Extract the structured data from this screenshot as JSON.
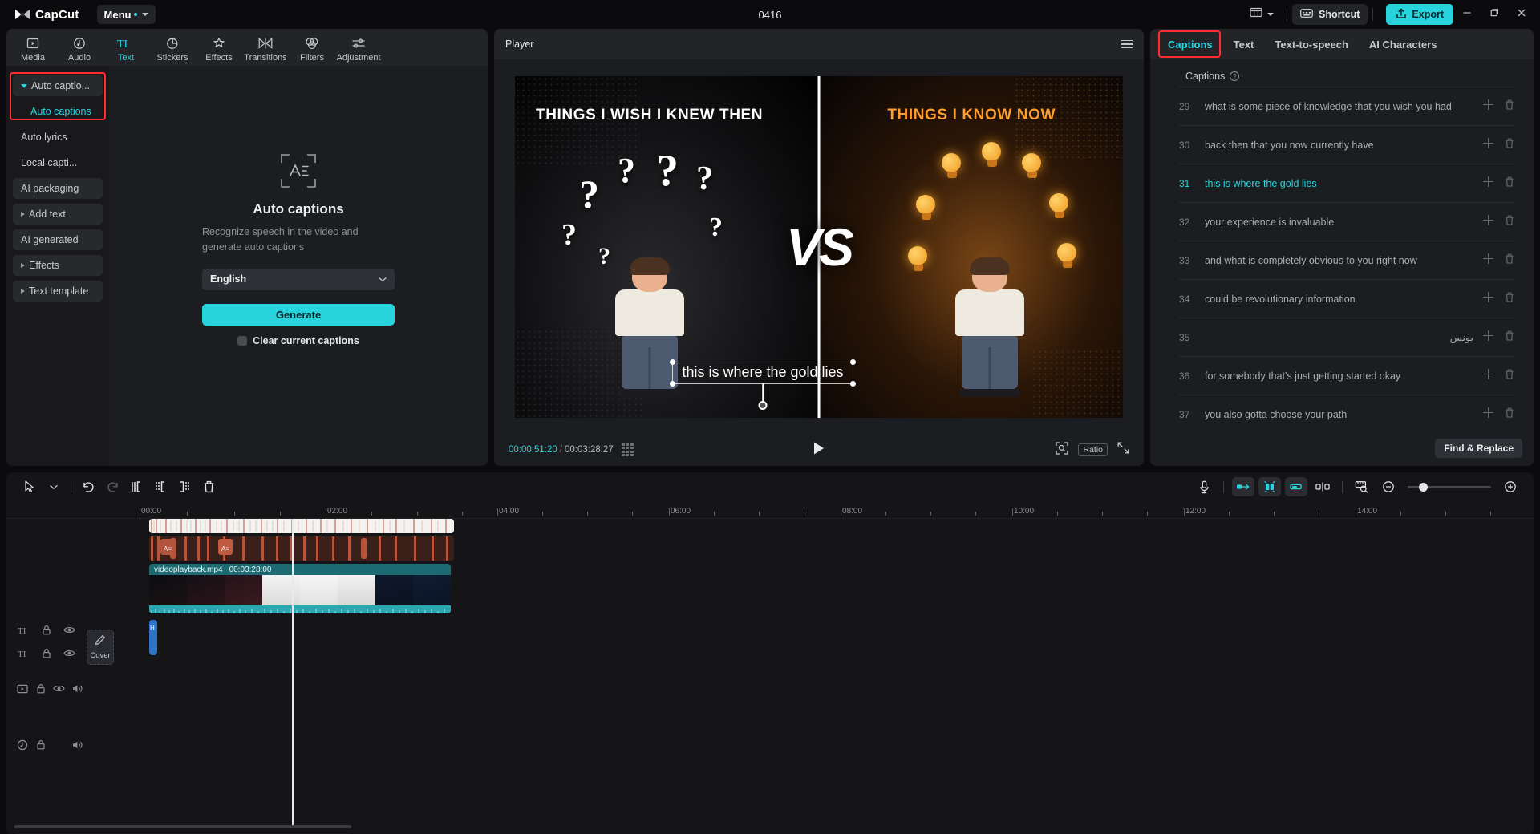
{
  "titlebar": {
    "app_name": "CapCut",
    "menu_label": "Menu",
    "project_title": "0416",
    "layout_icon": "layout-icon",
    "shortcut_label": "Shortcut",
    "export_label": "Export",
    "minimize_icon": "minimize-icon",
    "maximize_icon": "maximize-icon",
    "close_icon": "close-icon",
    "accent": "#27d4dd"
  },
  "toolstrip": {
    "items": [
      {
        "label": "Media",
        "icon": "media-icon",
        "active": false
      },
      {
        "label": "Audio",
        "icon": "audio-icon",
        "active": false
      },
      {
        "label": "Text",
        "icon": "text-icon",
        "active": true
      },
      {
        "label": "Stickers",
        "icon": "stickers-icon",
        "active": false
      },
      {
        "label": "Effects",
        "icon": "effects-icon",
        "active": false
      },
      {
        "label": "Transitions",
        "icon": "transitions-icon",
        "active": false
      },
      {
        "label": "Filters",
        "icon": "filters-icon",
        "active": false
      },
      {
        "label": "Adjustment",
        "icon": "adjustment-icon",
        "active": false
      }
    ]
  },
  "subnav": {
    "items": [
      {
        "label": "Auto captio...",
        "expandable": true,
        "expanded": true,
        "highlighted": true
      },
      {
        "label": "Auto captions",
        "child": true,
        "selected": true
      },
      {
        "label": "Auto lyrics",
        "expandable": false
      },
      {
        "label": "Local capti...",
        "expandable": false
      },
      {
        "label": "AI packaging",
        "expandable": false
      },
      {
        "label": "Add text",
        "expandable": true
      },
      {
        "label": "AI generated",
        "expandable": false
      },
      {
        "label": "Effects",
        "expandable": true
      },
      {
        "label": "Text template",
        "expandable": true
      }
    ]
  },
  "auto_captions": {
    "icon": "auto-captions-icon",
    "title": "Auto captions",
    "description": "Recognize speech in the video and generate auto captions",
    "language_value": "English",
    "generate_label": "Generate",
    "clear_label": "Clear current captions",
    "clear_checked": false
  },
  "player": {
    "title": "Player",
    "menu_icon": "hamburger-icon",
    "current_time": "00:00:51:20",
    "time_separator": "/",
    "total_time": "00:03:28:27",
    "frames_icon": "frames-icon",
    "play_icon": "play-icon",
    "fit_icon": "fit-to-screen-icon",
    "ratio_label": "Ratio",
    "fullscreen_icon": "fullscreen-icon",
    "video": {
      "left_title": "THINGS I WISH I KNEW THEN",
      "right_title": "THINGS I KNOW NOW",
      "vs_label": "VS",
      "caption_overlay": "this is where the gold lies"
    }
  },
  "right_panel": {
    "tabs": [
      {
        "label": "Captions",
        "active": true,
        "highlighted": true
      },
      {
        "label": "Text",
        "active": false
      },
      {
        "label": "Text-to-speech",
        "active": false
      },
      {
        "label": "AI Characters",
        "active": false
      }
    ],
    "section_label": "Captions",
    "help_icon": "help-icon",
    "find_replace_label": "Find & Replace",
    "add_icon": "plus-icon",
    "delete_icon": "trash-icon",
    "captions": [
      {
        "num": "29",
        "text": "what is some piece of knowledge that you wish you had",
        "active": false,
        "rtl": false
      },
      {
        "num": "30",
        "text": "back then that you now currently have",
        "active": false,
        "rtl": false
      },
      {
        "num": "31",
        "text": "this is where the gold lies",
        "active": true,
        "rtl": false
      },
      {
        "num": "32",
        "text": "your experience is invaluable",
        "active": false,
        "rtl": false
      },
      {
        "num": "33",
        "text": "and what is completely obvious to you right now",
        "active": false,
        "rtl": false
      },
      {
        "num": "34",
        "text": "could be revolutionary information",
        "active": false,
        "rtl": false
      },
      {
        "num": "35",
        "text": "یونس",
        "active": false,
        "rtl": true
      },
      {
        "num": "36",
        "text": "for somebody that's just getting started okay",
        "active": false,
        "rtl": false
      },
      {
        "num": "37",
        "text": "you also gotta choose your path",
        "active": false,
        "rtl": false
      }
    ]
  },
  "timeline": {
    "toolbar": {
      "select_icon": "select-arrow-icon",
      "select_caret_icon": "chevron-down-icon",
      "undo_icon": "undo-icon",
      "redo_icon": "redo-icon",
      "split_icon": "split-icon",
      "trim_left_icon": "trim-left-icon",
      "trim_right_icon": "trim-right-icon",
      "delete_icon": "delete-icon",
      "mic_icon": "microphone-icon",
      "keyframe_in_icon": "clip-in-icon",
      "mirror_icon": "mirror-icon",
      "keyframe_out_icon": "clip-out-icon",
      "separate_icon": "separate-audio-icon",
      "ruler_icon": "ruler-icon",
      "zoom_out_icon": "zoom-out-icon",
      "zoom_in_icon": "zoom-in-icon",
      "zoom_value": 14
    },
    "ruler_labels": [
      "00:00",
      "02:00",
      "04:00",
      "06:00",
      "08:00",
      "10:00",
      "12:00",
      "14:00"
    ],
    "cover_label": "Cover",
    "cover_icon": "pencil-icon",
    "track_heads": [
      {
        "type": "text",
        "icon": "TI",
        "lock_icon": "lock-icon",
        "eye_icon": "eye-icon",
        "audio_icon": null
      },
      {
        "type": "text",
        "icon": "TI",
        "lock_icon": "lock-icon",
        "eye_icon": "eye-icon",
        "audio_icon": null
      },
      {
        "type": "video",
        "icon": "video-icon",
        "lock_icon": "lock-icon",
        "eye_icon": "eye-icon",
        "audio_icon": "volume-icon"
      },
      {
        "type": "audio",
        "icon": "audio-clock-icon",
        "lock_icon": "lock-icon",
        "eye_icon": null,
        "audio_icon": "volume-icon"
      }
    ],
    "video_clip": {
      "name": "videoplayback.mp4",
      "duration": "00:03:28:00"
    },
    "audio_clip_label": "H"
  }
}
